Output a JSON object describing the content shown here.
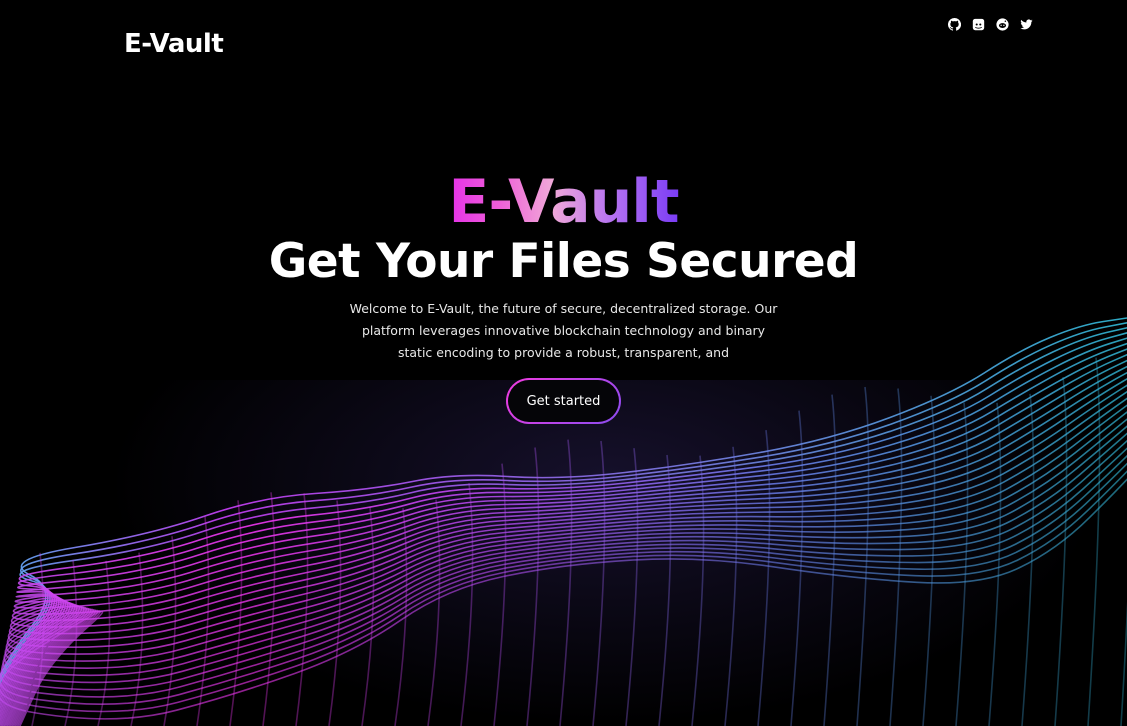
{
  "header": {
    "logo_text": "E-Vault",
    "socials": [
      {
        "name": "github",
        "icon": "github-icon"
      },
      {
        "name": "discord",
        "icon": "discord-icon"
      },
      {
        "name": "reddit",
        "icon": "reddit-icon"
      },
      {
        "name": "twitter",
        "icon": "twitter-icon"
      }
    ]
  },
  "hero": {
    "brand": "E-Vault",
    "headline": "Get Your Files Secured",
    "description": "Welcome to E-Vault, the future of secure, decentralized storage. Our platform leverages innovative blockchain technology and binary static encoding to provide a robust, transparent, and",
    "cta_label": "Get started"
  },
  "colors": {
    "background": "#000000",
    "accent_magenta": "#f23be0",
    "accent_purple": "#8a4cf0",
    "accent_teal": "#35b6d6"
  }
}
